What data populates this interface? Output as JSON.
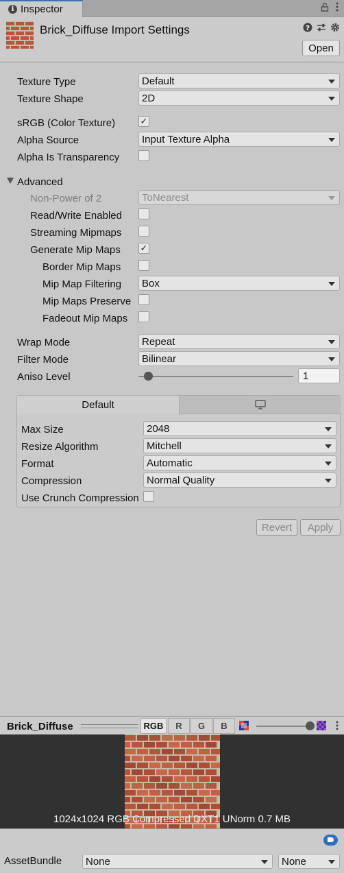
{
  "tab": {
    "label": "Inspector",
    "icon": "info-icon"
  },
  "header": {
    "title": "Brick_Diffuse Import Settings",
    "open_label": "Open",
    "icons": [
      "help-icon",
      "preset-icon",
      "gear-icon"
    ]
  },
  "basic": {
    "texture_type": {
      "label": "Texture Type",
      "value": "Default"
    },
    "texture_shape": {
      "label": "Texture Shape",
      "value": "2D"
    },
    "srgb": {
      "label": "sRGB (Color Texture)",
      "checked": true
    },
    "alpha_source": {
      "label": "Alpha Source",
      "value": "Input Texture Alpha"
    },
    "alpha_transparency": {
      "label": "Alpha Is Transparency",
      "checked": false
    }
  },
  "advanced": {
    "label": "Advanced",
    "non_power_of_2": {
      "label": "Non-Power of 2",
      "value": "ToNearest"
    },
    "read_write": {
      "label": "Read/Write Enabled",
      "checked": false
    },
    "streaming_mipmaps": {
      "label": "Streaming Mipmaps",
      "checked": false
    },
    "generate_mip_maps": {
      "label": "Generate Mip Maps",
      "checked": true
    },
    "border_mip_maps": {
      "label": "Border Mip Maps",
      "checked": false
    },
    "mip_map_filtering": {
      "label": "Mip Map Filtering",
      "value": "Box"
    },
    "mip_maps_preserve": {
      "label": "Mip Maps Preserve",
      "checked": false
    },
    "fadeout_mip_maps": {
      "label": "Fadeout Mip Maps",
      "checked": false
    }
  },
  "wrap": {
    "wrap_mode": {
      "label": "Wrap Mode",
      "value": "Repeat"
    },
    "filter_mode": {
      "label": "Filter Mode",
      "value": "Bilinear"
    },
    "aniso_level": {
      "label": "Aniso Level",
      "value": "1",
      "fraction": 0.06
    }
  },
  "platform": {
    "tab_default": "Default",
    "tab_standalone_icon": "monitor-icon",
    "max_size": {
      "label": "Max Size",
      "value": "2048"
    },
    "resize_algorithm": {
      "label": "Resize Algorithm",
      "value": "Mitchell"
    },
    "format": {
      "label": "Format",
      "value": "Automatic"
    },
    "compression": {
      "label": "Compression",
      "value": "Normal Quality"
    },
    "crunch": {
      "label": "Use Crunch Compression",
      "checked": false
    }
  },
  "actions": {
    "revert": "Revert",
    "apply": "Apply"
  },
  "preview": {
    "name": "Brick_Diffuse",
    "channels": [
      "RGB",
      "R",
      "G",
      "B"
    ],
    "active_channel": "RGB",
    "mip_fraction": 1.0,
    "info": "1024x1024  RGB Compressed DXT1 UNorm   0.7 MB"
  },
  "assetbundle": {
    "label": "AssetBundle",
    "name_value": "None",
    "variant_value": "None"
  },
  "colors": {
    "accent": "#3a72b0",
    "preview_bg": "#313131",
    "brick": "#b4573c",
    "mortar": "#c9b9a6"
  }
}
